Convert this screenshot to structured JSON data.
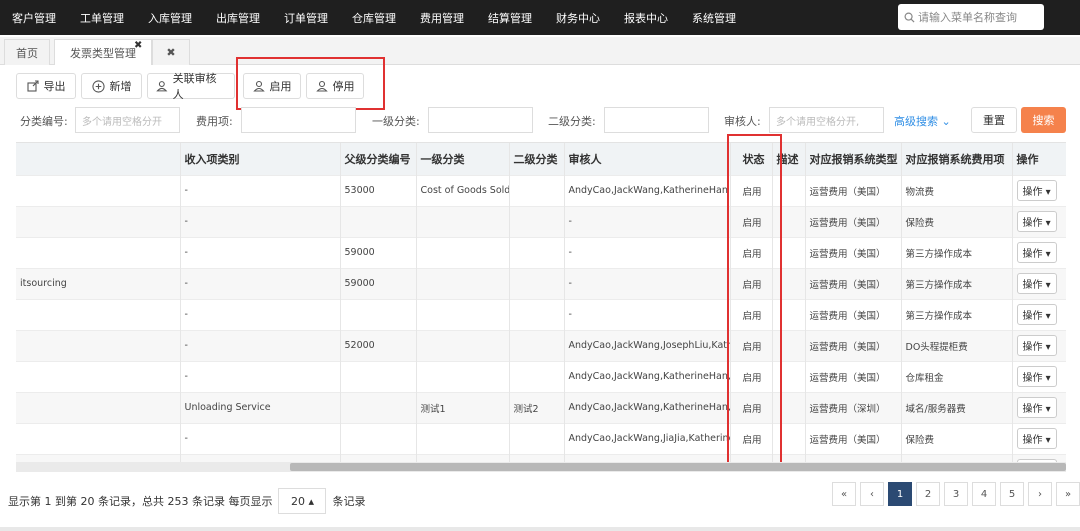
{
  "nav": {
    "items": [
      "客户管理",
      "工单管理",
      "入库管理",
      "出库管理",
      "订单管理",
      "仓库管理",
      "费用管理",
      "结算管理",
      "财务中心",
      "报表中心",
      "系统管理"
    ],
    "search_placeholder": "请输入菜单名称查询"
  },
  "tabs": {
    "home": "首页",
    "fee_type": "发票类型管理",
    "close_glyph": "✖",
    "close_all": "✖"
  },
  "toolbar": {
    "export": "导出",
    "add": "新增",
    "link_reviewer": "关联审核人",
    "enable": "启用",
    "disable": "停用"
  },
  "filters": {
    "code_label": "分类编号:",
    "code_placeholder": "多个请用空格分开",
    "fee_label": "费用项:",
    "level1_label": "一级分类:",
    "level2_label": "二级分类:",
    "reviewer_label": "审核人:",
    "reviewer_placeholder": "多个请用空格分开,",
    "advanced": "高级搜索",
    "advanced_caret": "⌄",
    "reset": "重置",
    "search": "搜索"
  },
  "table": {
    "columns": [
      "",
      "收入项类别",
      "父级分类编号",
      "一级分类",
      "二级分类",
      "审核人",
      "状态",
      "描述",
      "对应报销系统类型",
      "对应报销系统费用项",
      "操作"
    ],
    "op_label": "操作 ▾",
    "rows": [
      [
        "",
        "-",
        "53000",
        "Cost of Goods Sold",
        "",
        "AndyCao,JackWang,KatherineHan",
        "启用",
        "",
        "运营费用（美国）",
        "物流费"
      ],
      [
        "",
        "-",
        "",
        "",
        "",
        "-",
        "启用",
        "",
        "运营费用（美国）",
        "保险费"
      ],
      [
        "",
        "-",
        "59000",
        "",
        "",
        "-",
        "启用",
        "",
        "运营费用（美国）",
        "第三方操作成本"
      ],
      [
        "itsourcing",
        "-",
        "59000",
        "",
        "",
        "-",
        "启用",
        "",
        "运营费用（美国）",
        "第三方操作成本"
      ],
      [
        "",
        "-",
        "",
        "",
        "",
        "-",
        "启用",
        "",
        "运营费用（美国）",
        "第三方操作成本"
      ],
      [
        "",
        "-",
        "52000",
        "",
        "",
        "AndyCao,JackWang,JosephLiu,Kathe...",
        "启用",
        "",
        "运营费用（美国）",
        "DO头程提柜费"
      ],
      [
        "",
        "-",
        "",
        "",
        "",
        "AndyCao,JackWang,KatherineHan,Yv...",
        "启用",
        "",
        "运营费用（美国）",
        "仓库租金"
      ],
      [
        "",
        "Unloading Service",
        "",
        "测试1",
        "测试2",
        "AndyCao,JackWang,KatherineHan,Yv...",
        "启用",
        "",
        "运营费用（深圳）",
        "域名/服务器费"
      ],
      [
        "",
        "-",
        "",
        "",
        "",
        "AndyCao,JackWang,JiaJia,Katherine...",
        "启用",
        "",
        "运营费用（美国）",
        "保险费"
      ],
      [
        "",
        "",
        "",
        "",
        "",
        "",
        "",
        "",
        "",
        ""
      ]
    ]
  },
  "footer": {
    "summary": "显示第 1 到第 20 条记录，总共 253 条记录 每页显示",
    "page_size": "20 ▴",
    "suffix": "条记录"
  },
  "pager": {
    "first": "«",
    "prev": "‹",
    "pages": [
      "1",
      "2",
      "3",
      "4",
      "5"
    ],
    "next": "›",
    "last": "»",
    "current": "1"
  },
  "colors": {
    "nav_bg": "#1f1f1f",
    "accent": "#f5824c",
    "highlight_box": "#e03131",
    "link": "#2f8ee5",
    "pager_active": "#2b4a73"
  }
}
